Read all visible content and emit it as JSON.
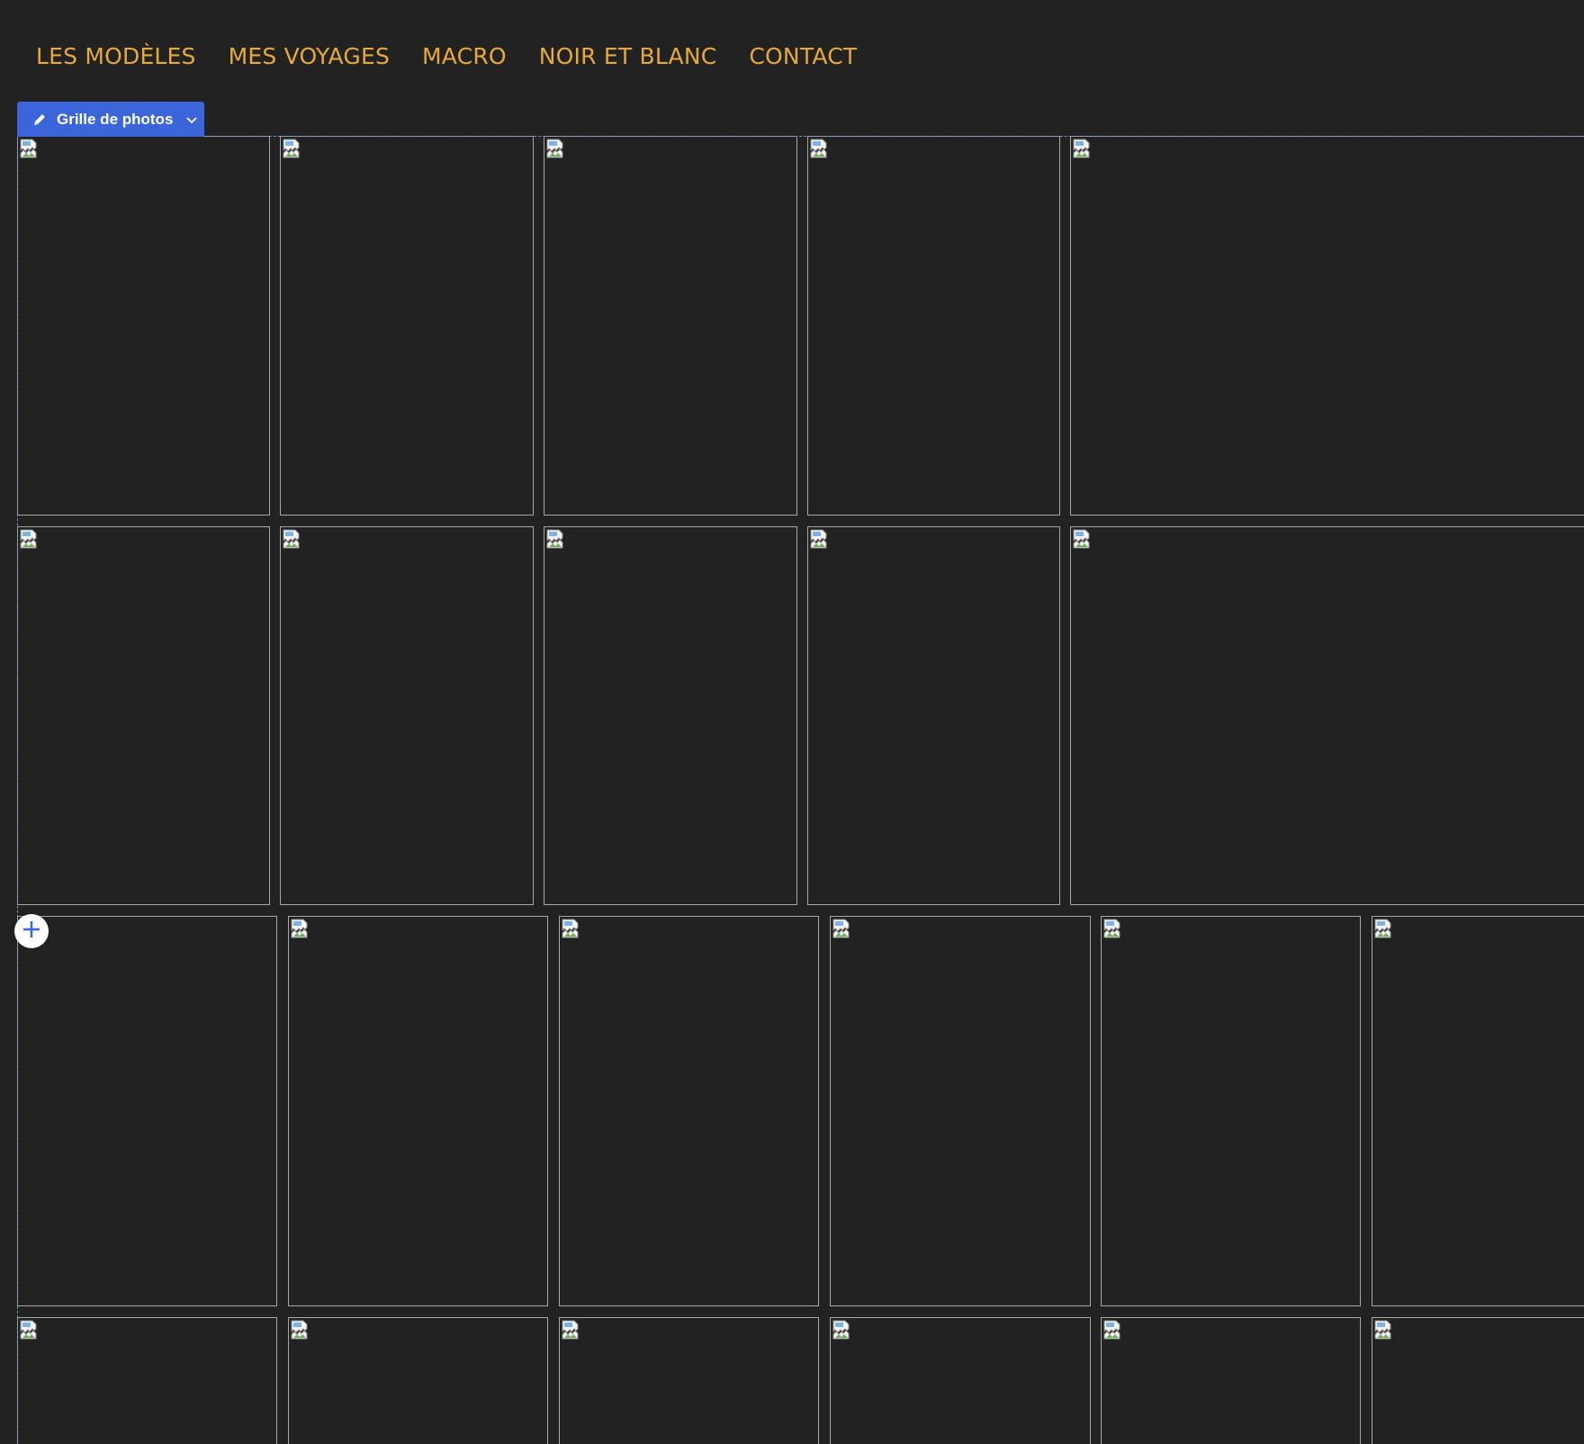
{
  "nav": {
    "items": [
      {
        "label": "LES MODÈLES"
      },
      {
        "label": "MES VOYAGES"
      },
      {
        "label": "MACRO"
      },
      {
        "label": "NOIR ET BLANC"
      },
      {
        "label": "CONTACT"
      }
    ]
  },
  "toolbar": {
    "edit_icon": "pencil-icon",
    "label": "Grille de photos",
    "dropdown_icon": "chevron-down-icon"
  },
  "gallery": {
    "image_icon": "broken-image-icon",
    "add_icon": "plus-icon",
    "rows": [
      {
        "tiles": 5
      },
      {
        "tiles": 5
      },
      {
        "tiles": 6
      },
      {
        "tiles": 6
      }
    ]
  },
  "colors": {
    "background": "#222222",
    "nav_text": "#e7a93a",
    "toolbar_bg": "#3b65d8",
    "tile_border": "#a9a9a9",
    "selection_outline": "#7d95c9"
  }
}
